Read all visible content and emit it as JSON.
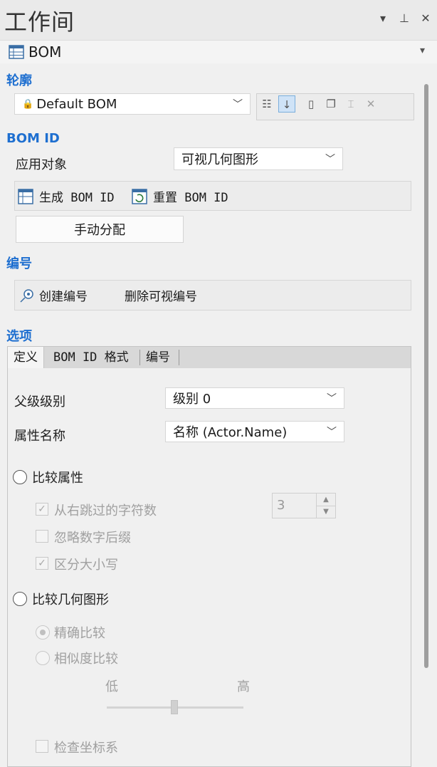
{
  "window": {
    "title": "工作间",
    "controls": {
      "menu_icon": "▾",
      "pin_icon": "⊥",
      "close_icon": "✕"
    }
  },
  "panel": {
    "label": "BOM",
    "icon": "table-icon",
    "dropdown_icon": "▾"
  },
  "outline": {
    "section_title": "轮廓",
    "selected_bom": "Default BOM",
    "lock_icon": "🔒"
  },
  "bom_id": {
    "section_title": "BOM ID",
    "apply_label": "应用对象",
    "apply_value": "可视几何图形",
    "generate_label": "生成 BOM ID",
    "reset_label": "重置 BOM ID",
    "manual_assign_label": "手动分配"
  },
  "numbering": {
    "section_title": "编号",
    "create_label": "创建编号",
    "delete_label": "删除可视编号"
  },
  "options": {
    "section_title": "选项",
    "tabs": [
      {
        "label": "定义"
      },
      {
        "label": "BOM ID 格式"
      },
      {
        "label": "编号"
      }
    ],
    "parent_level_label": "父级级别",
    "parent_level_value": "级别 0",
    "attr_name_label": "属性名称",
    "attr_name_value": "名称 (Actor.Name)",
    "compare_attr_label": "比较属性",
    "skip_chars_label": "从右跳过的字符数",
    "skip_chars_value": "3",
    "ignore_suffix_label": "忽略数字后缀",
    "case_sensitive_label": "区分大小写",
    "compare_geom_label": "比较几何图形",
    "exact_label": "精确比较",
    "similarity_label": "相似度比较",
    "slider_low": "低",
    "slider_high": "高",
    "check_coord_label": "检查坐标系"
  },
  "colors": {
    "accent": "#1e6fd0",
    "background": "#f0f0f0"
  }
}
